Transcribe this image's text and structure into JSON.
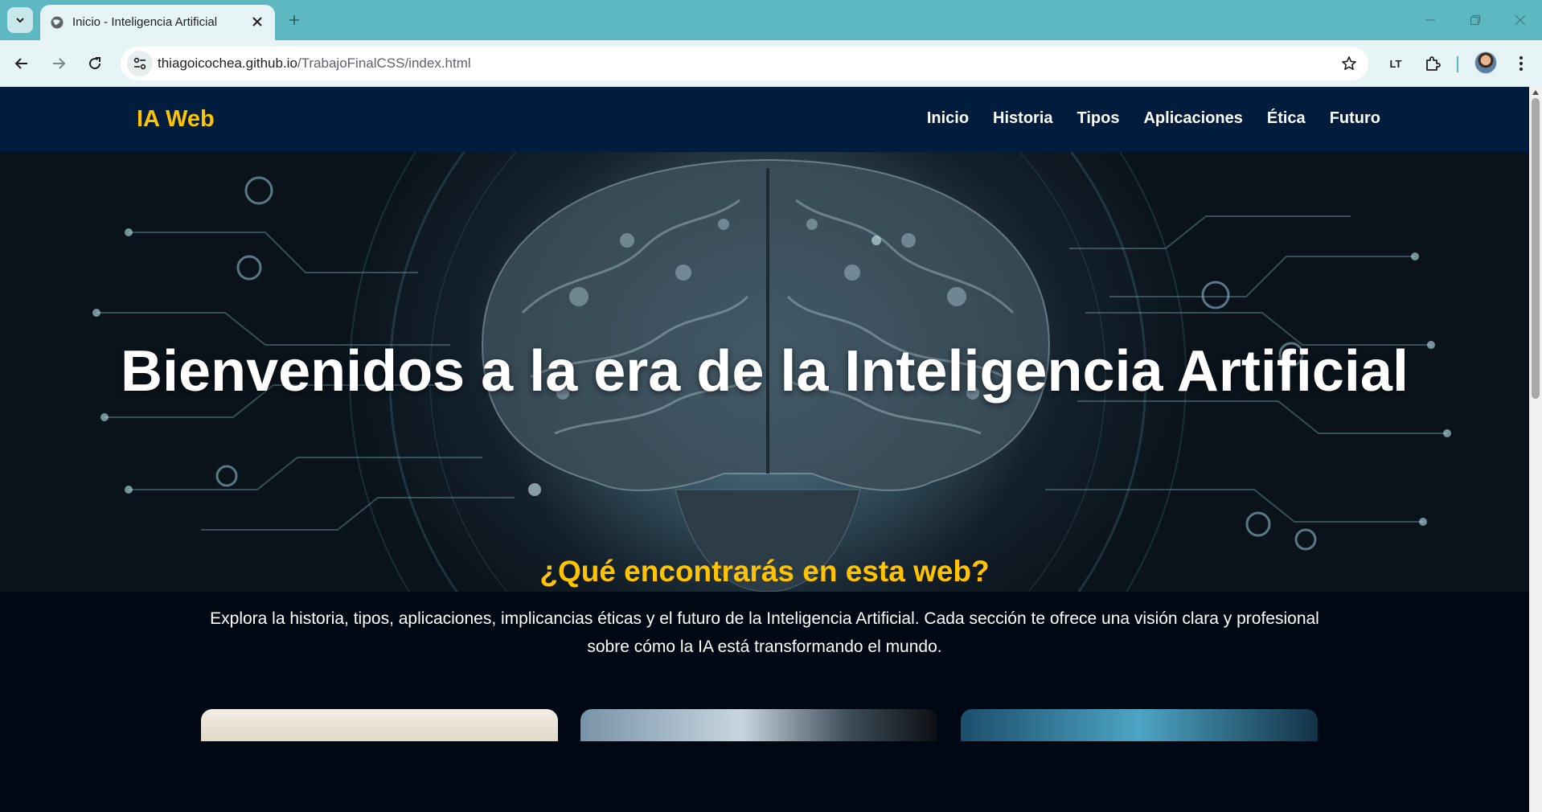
{
  "browser": {
    "tab": {
      "title": "Inicio - Inteligencia Artificial"
    },
    "url": {
      "host": "thiagoicochea.github.io",
      "path": "/TrabajoFinalCSS/index.html"
    },
    "extension_badge": "LT"
  },
  "site": {
    "logo": "IA Web",
    "nav": [
      "Inicio",
      "Historia",
      "Tipos",
      "Aplicaciones",
      "Ética",
      "Futuro"
    ],
    "hero_title": "Bienvenidos a la era de la Inteligencia Artificial",
    "intro": {
      "title": "¿Qué encontrarás en esta web?",
      "text": "Explora la historia, tipos, aplicaciones, implicancias éticas y el futuro de la Inteligencia Artificial. Cada sección te ofrece una visión clara y profesional sobre cómo la IA está transformando el mundo."
    }
  },
  "colors": {
    "tabstrip": "#5db8c2",
    "site_header": "#001d3d",
    "page_bg": "#000814",
    "accent": "#ffc300"
  },
  "icons": [
    "tab-search-icon",
    "globe-icon",
    "close-icon",
    "plus-icon",
    "minimize-icon",
    "restore-icon",
    "back-icon",
    "forward-icon",
    "reload-icon",
    "site-settings-icon",
    "star-icon",
    "extensions-icon",
    "more-icon"
  ]
}
